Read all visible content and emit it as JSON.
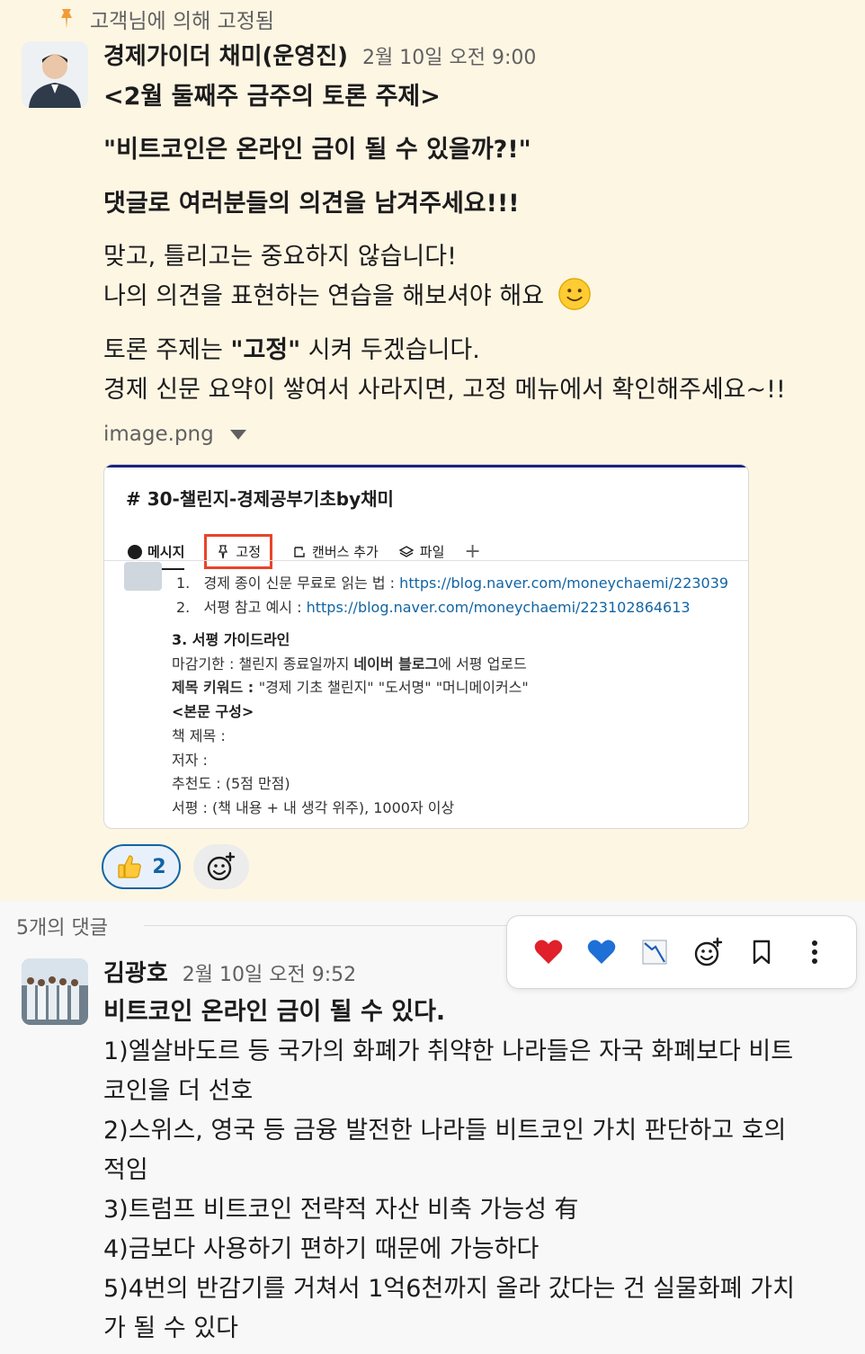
{
  "pinned_banner": {
    "label": "고객님에 의해 고정됨",
    "icon": "pin-icon"
  },
  "message": {
    "author": "경제가이더 채미(운영진)",
    "timestamp": "2월 10일 오전 9:00",
    "heading": "<2월 둘째주 금주의 토론 주제>",
    "topic": "\"비트코인은 온라인 금이 될 수 있을까?!\"",
    "call_to_action": "댓글로 여러분들의 의견을 남겨주세요!!!",
    "line1": "맞고, 틀리고는 중요하지 않습니다!",
    "line2": "나의 의견을 표현하는 연습을 해보셔야 해요",
    "line3_pre": "토론 주제는 ",
    "line3_bold": "\"고정\"",
    "line3_post": " 시켜 두겠습니다.",
    "line4": "경제 신문 요약이 쌓여서 사라지면, 고정 메뉴에서 확인해주세요~!!",
    "attachment_name": "image.png"
  },
  "embed": {
    "channel_title": "# 30-챌린지-경제공부기초by채미",
    "tabs": {
      "messages": "메시지",
      "pinned": "고정",
      "canvas": "캔버스 추가",
      "files": "파일",
      "add": "+"
    },
    "list": [
      {
        "num": "1.",
        "text": "경제 종이 신문 무료로 읽는 법 : ",
        "link": "https://blog.naver.com/moneychaemi/223039"
      },
      {
        "num": "2.",
        "text": "서평 참고 예시 : ",
        "link": "https://blog.naver.com/moneychaemi/223102864613"
      }
    ],
    "section_title": "3. 서평 가이드라인",
    "deadline_pre": "마감기한 : 챌린지 종료일까지 ",
    "deadline_bold": "네이버 블로그",
    "deadline_post": "에 서평 업로드",
    "keyword_label": "제목 키워드 : ",
    "keyword_value": "\"경제 기초 챌린지\" \"도서명\" \"머니메이커스\"",
    "body_title": "<본문 구성>",
    "book_title": "책 제목 :",
    "writer": "저자 :",
    "rating": "추천도 : (5점 만점)",
    "review": "서평 : (책 내용 + 내 생각 위주), 1000자 이상"
  },
  "reactions": [
    {
      "emoji": "thumbs-up",
      "count": "2"
    }
  ],
  "replies": {
    "count_label": "5개의 댓글"
  },
  "reply": {
    "author": "김광호",
    "timestamp": "2월 10일 오전 9:52",
    "title": "비트코인 온라인 금이 될 수 있다.",
    "lines": [
      "1)엘살바도르 등 국가의 화폐가 취약한 나라들은 자국 화폐보다 비트",
      "코인을 더 선호",
      "2)스위스, 영국 등 금융 발전한 나라들 비트코인 가치 판단하고 호의",
      "적임",
      "3)트럼프 비트코인 전략적 자산 비축 가능성 有",
      "4)금보다 사용하기 편하기 때문에 가능하다",
      "5)4번의 반감기를 거쳐서 1억6천까지 올라 갔다는 건 실물화폐 가치",
      "가 될 수 있다"
    ]
  },
  "hover_toolbar": [
    "red-heart",
    "blue-heart",
    "chart-down",
    "add-reaction",
    "bookmark",
    "more"
  ],
  "colors": {
    "pinned_bg": "#fdf6e3",
    "link": "#1264a3",
    "highlight_box": "#e8442a"
  }
}
